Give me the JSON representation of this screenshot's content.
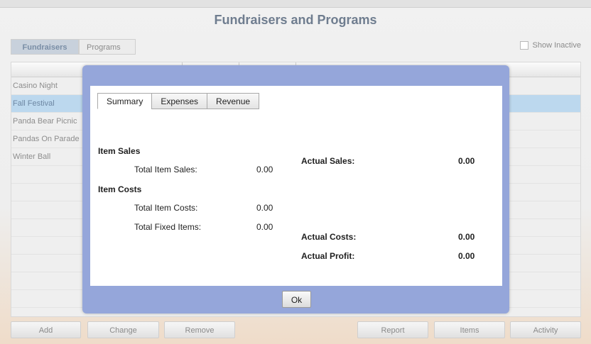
{
  "page": {
    "title": "Fundraisers and Programs"
  },
  "tabs": [
    {
      "label": "Fundraisers",
      "active": true
    },
    {
      "label": "Programs",
      "active": false
    }
  ],
  "show_inactive": {
    "label": "Show Inactive",
    "checked": false
  },
  "list": {
    "rows": [
      {
        "label": "Casino Night",
        "selected": false
      },
      {
        "label": "Fall Festival",
        "selected": true
      },
      {
        "label": "Panda Bear Picnic",
        "selected": false
      },
      {
        "label": "Pandas On Parade",
        "selected": false
      },
      {
        "label": "Winter Ball",
        "selected": false
      }
    ]
  },
  "buttons": {
    "add": "Add",
    "change": "Change",
    "remove": "Remove",
    "report": "Report",
    "items": "Items",
    "activity": "Activity"
  },
  "modal": {
    "tabs": [
      {
        "label": "Summary",
        "active": true
      },
      {
        "label": "Expenses",
        "active": false
      },
      {
        "label": "Revenue",
        "active": false
      }
    ],
    "item_sales_header": "Item Sales",
    "total_item_sales_label": "Total Item Sales:",
    "total_item_sales_value": "0.00",
    "item_costs_header": "Item Costs",
    "total_item_costs_label": "Total Item Costs:",
    "total_item_costs_value": "0.00",
    "total_fixed_items_label": "Total Fixed Items:",
    "total_fixed_items_value": "0.00",
    "actual_sales_label": "Actual Sales:",
    "actual_sales_value": "0.00",
    "actual_costs_label": "Actual Costs:",
    "actual_costs_value": "0.00",
    "actual_profit_label": "Actual Profit:",
    "actual_profit_value": "0.00",
    "ok_label": "Ok"
  },
  "colors": {
    "modal_frame": "#95a6da",
    "selected_row": "#bcd8ee",
    "title_text": "#6f7d8f"
  }
}
